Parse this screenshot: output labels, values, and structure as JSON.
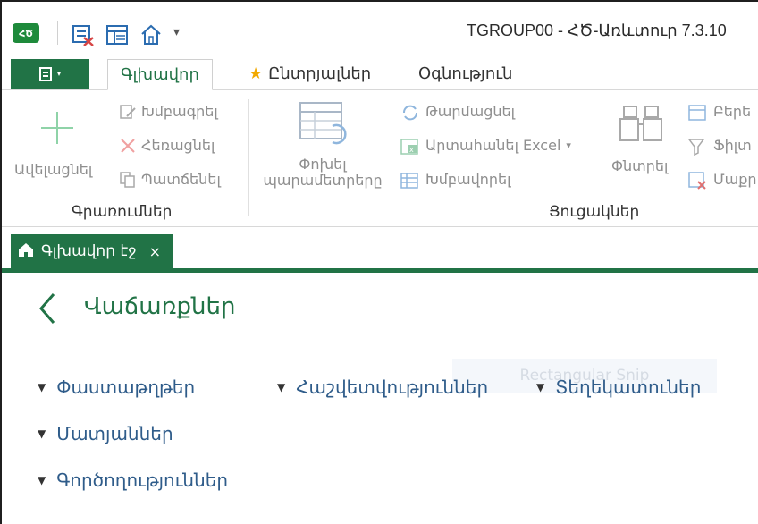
{
  "window": {
    "title": "TGROUP00 - ՀԾ-Առևտուր 7.3.10",
    "app_logo_text": "ՀԾ"
  },
  "quick_access": {
    "icons": [
      "exit-icon",
      "table-view-icon",
      "home-icon",
      "dropdown-icon"
    ]
  },
  "ribbon": {
    "tabs": [
      "Գլխավոր",
      "Ընտրյալներ",
      "Օգնություն"
    ],
    "active_tab": "Գլխավոր",
    "groups": {
      "operations": {
        "label": "Գրառումներ",
        "add": "Ավելացնել",
        "edit": "Խմբագրել",
        "delete": "Հեռացնել",
        "copy": "Պատճենել"
      },
      "lists": {
        "label": "Ցուցակներ",
        "change_params_line1": "Փոխել",
        "change_params_line2": "պարամետրերը",
        "refresh": "Թարմացնել",
        "export_excel": "Արտահանել Excel",
        "group": "Խմբավորել",
        "search": "Փնտրել",
        "open": "Բերե",
        "filter": "Ֆիլտ",
        "sort": "Մաքր"
      }
    }
  },
  "doc_tab": {
    "label": "Գլխավոր էջ",
    "close": "×"
  },
  "main": {
    "page_title": "Վաճառքներ",
    "sections": [
      "Փաստաթղթեր",
      "Հաշվետվություններ",
      "Տեղեկատուներ",
      "Մատյաններ",
      "Գործողություններ"
    ],
    "snip_overlay": "Rectangular Snip"
  },
  "colors": {
    "brand_green": "#217346",
    "link_blue": "#2f5c8a",
    "star": "#f2a900"
  }
}
